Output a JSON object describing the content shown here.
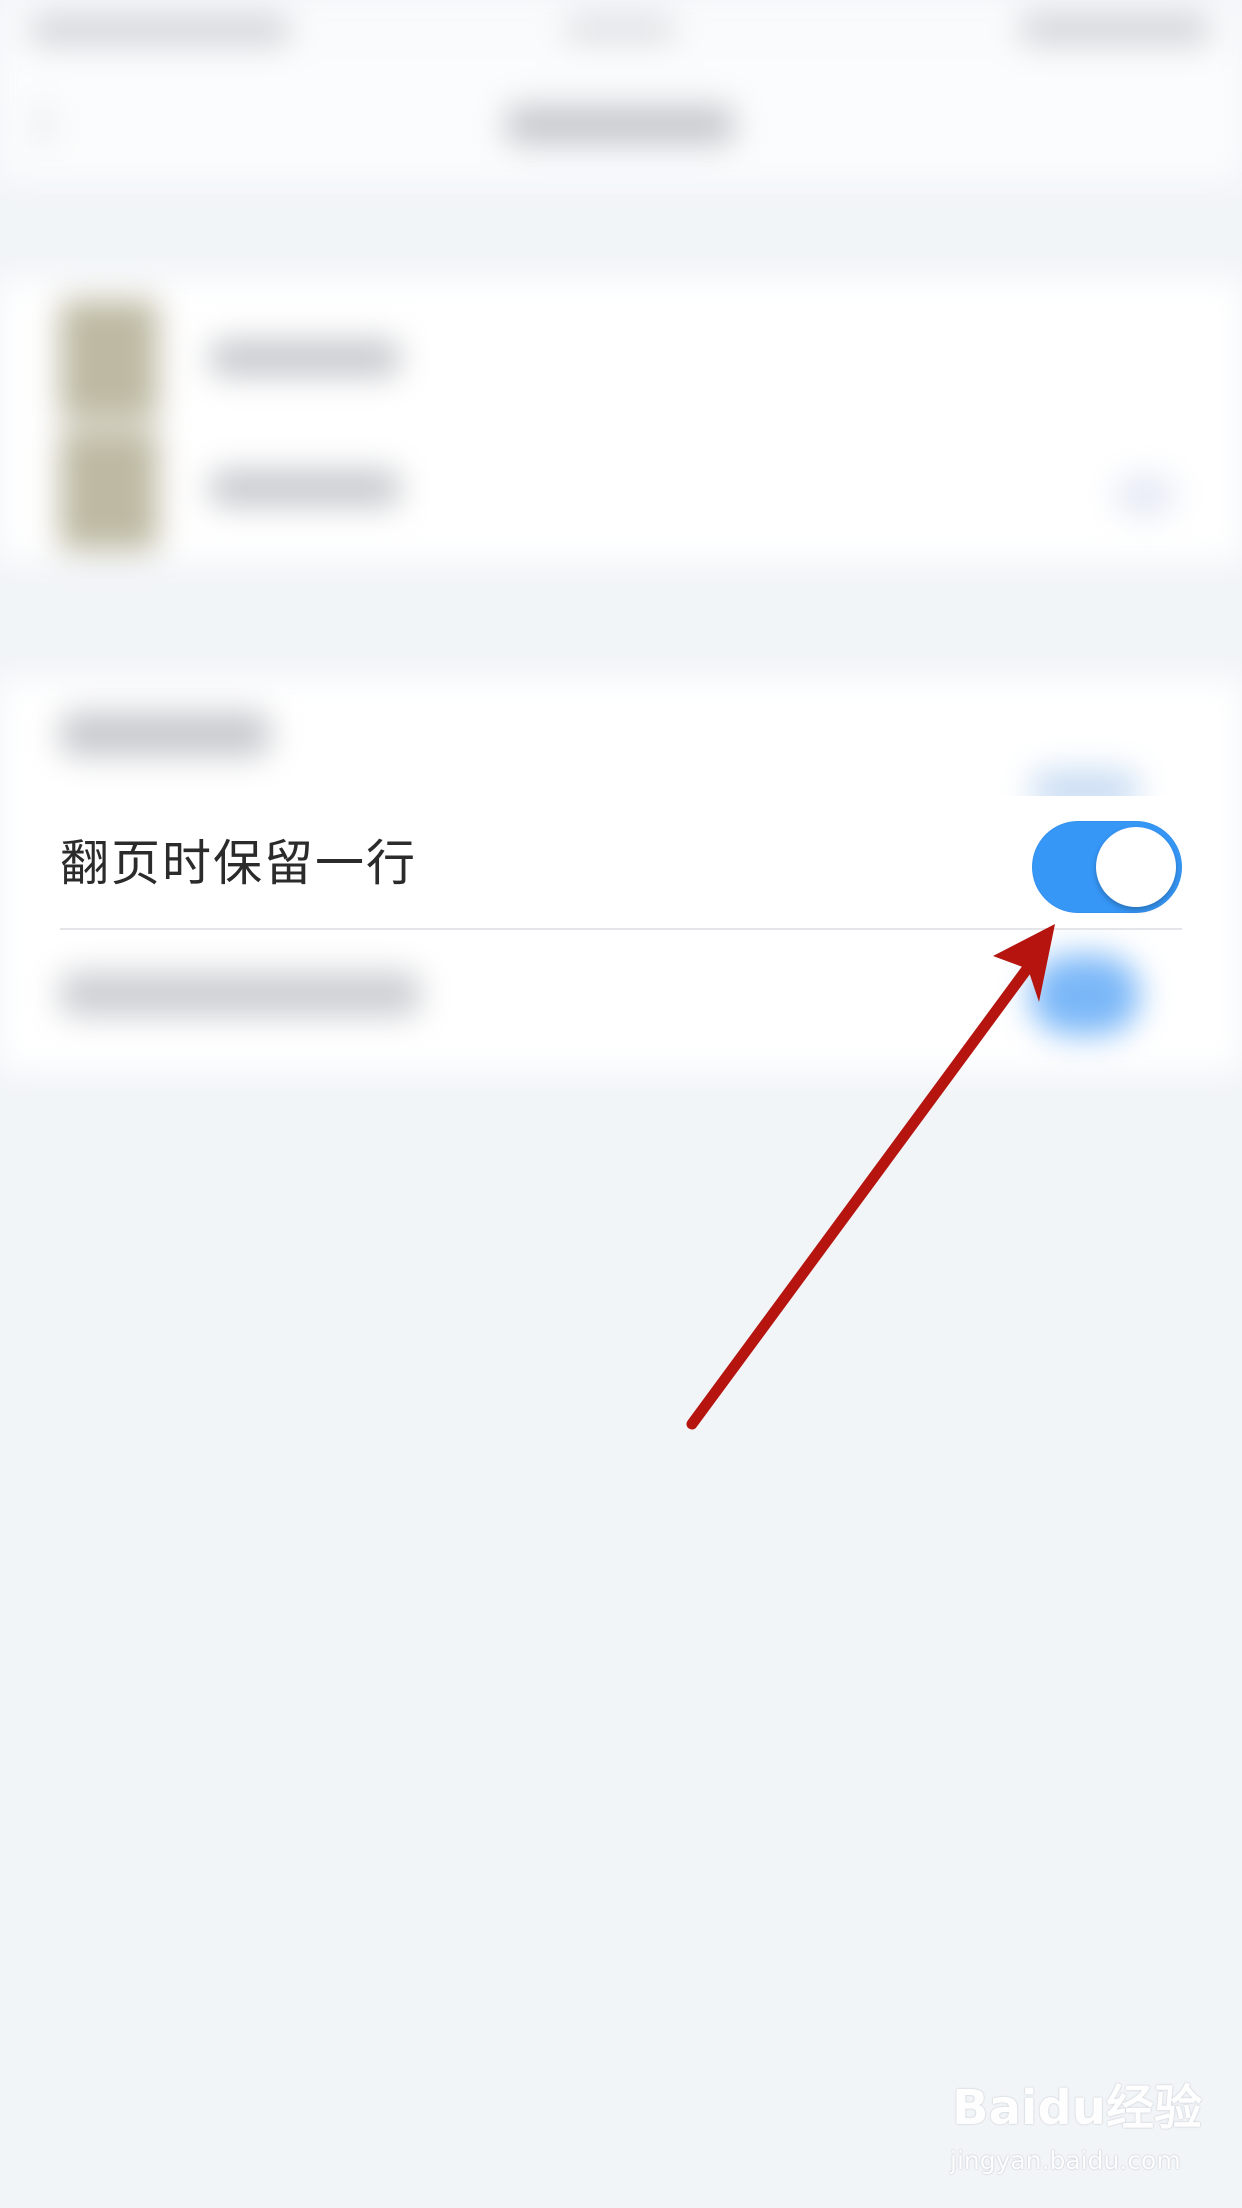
{
  "setting": {
    "label": "翻页时保留一行",
    "toggle_on": true
  },
  "colors": {
    "toggle_active": "#3697f7",
    "annotation_arrow": "#b5140f",
    "page_background": "#f2f5f8"
  },
  "watermark": {
    "logo": "Baidu经验",
    "url": "jingyan.baidu.com"
  }
}
